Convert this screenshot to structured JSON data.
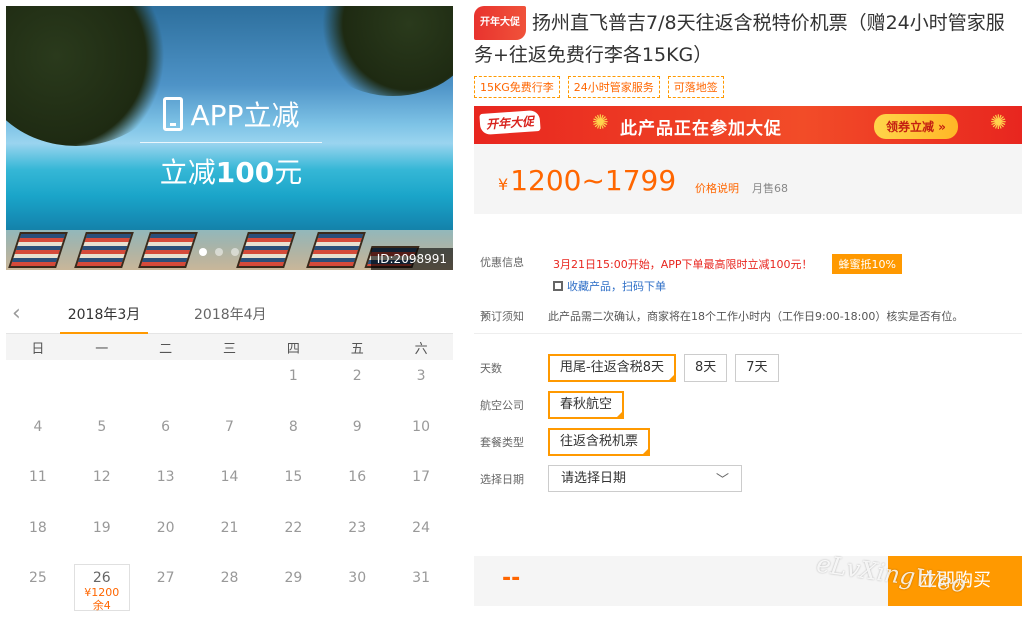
{
  "hero": {
    "overlay_line1": "APP立减",
    "overlay_line2_prefix": "立减",
    "overlay_line2_amount": "100",
    "overlay_line2_suffix": "元",
    "id_tag": "ID:2098991",
    "slide_count": 3,
    "active_slide": 1
  },
  "calendar": {
    "months": [
      "2018年3月",
      "2018年4月"
    ],
    "active_month": "2018年3月",
    "weekdays": [
      "日",
      "一",
      "二",
      "三",
      "四",
      "五",
      "六"
    ],
    "rows": [
      [
        "",
        "",
        "",
        "",
        "1",
        "2",
        "3"
      ],
      [
        "4",
        "5",
        "6",
        "7",
        "8",
        "9",
        "10"
      ],
      [
        "11",
        "12",
        "13",
        "14",
        "15",
        "16",
        "17"
      ],
      [
        "18",
        "19",
        "20",
        "21",
        "22",
        "23",
        "24"
      ],
      [
        "25",
        "26",
        "27",
        "28",
        "29",
        "30",
        "31"
      ]
    ],
    "available": {
      "day": "26",
      "price": "¥1200",
      "stock": "余4"
    }
  },
  "product": {
    "badge": "开年大促",
    "title": "扬州直飞普吉7/8天往返含税特价机票（赠24小时管家服务+往返免费行李各15KG）",
    "tags": [
      "15KG免费行李",
      "24小时管家服务",
      "可落地签"
    ],
    "promo": {
      "badge": "开年大促",
      "text": "此产品正在参加大促",
      "button": "领券立减 »"
    },
    "price": {
      "currency": "¥",
      "range": "1200~1799",
      "note": "价格说明",
      "sold": "月售68"
    }
  },
  "info": {
    "discount_label": "优惠信息",
    "discount_text": "3月21日15:00开始，APP下单最高限时立减100元！",
    "honey_label": "蜂蜜抵10%",
    "collect_link": "收藏产品",
    "scan_link": "扫码下单",
    "booking_label": "预订须知",
    "booking_text": "此产品需二次确认，商家将在18个工作小时内（工作日9:00-18:00）核实是否有位。"
  },
  "options": {
    "days_label": "天数",
    "days": [
      "甩尾-往返含税8天",
      "8天",
      "7天"
    ],
    "days_selected": 0,
    "airline_label": "航空公司",
    "airline": "春秋航空",
    "package_label": "套餐类型",
    "package": "往返含税机票",
    "date_label": "选择日期",
    "date_placeholder": "请选择日期"
  },
  "buy": {
    "price": "--",
    "button": "立即购买"
  },
  "watermark": "eLvXingWeo"
}
